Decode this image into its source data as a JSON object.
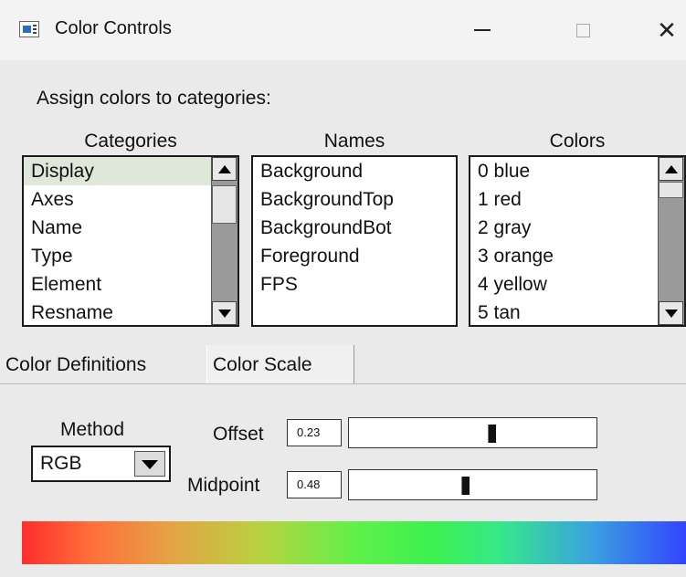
{
  "window": {
    "title": "Color Controls",
    "minimize_glyph": "—",
    "close_glyph": "✕"
  },
  "heading": "Assign colors to categories:",
  "categories": {
    "label": "Categories",
    "items": [
      "Display",
      "Axes",
      "Name",
      "Type",
      "Element",
      "Resname"
    ],
    "selected": "Display"
  },
  "names": {
    "label": "Names",
    "items": [
      "Background",
      "BackgroundTop",
      "BackgroundBot",
      "Foreground",
      "FPS"
    ]
  },
  "colors": {
    "label": "Colors",
    "items": [
      "0 blue",
      "1 red",
      "2 gray",
      "3 orange",
      "4 yellow",
      "5 tan"
    ]
  },
  "tabs": [
    {
      "label": "Color Definitions",
      "active": false
    },
    {
      "label": "Color Scale",
      "active": true
    }
  ],
  "scale": {
    "method_label": "Method",
    "method_value": "RGB",
    "offset_label": "Offset",
    "offset_value": "0.23",
    "offset_fraction": 0.58,
    "midpoint_label": "Midpoint",
    "midpoint_value": "0.48",
    "midpoint_fraction": 0.47
  },
  "colors_hex": {
    "gradient": [
      "#ff2d2d",
      "#e6a145",
      "#62f04a",
      "#35e88a",
      "#3344ff"
    ],
    "selection": "#dfe7d9"
  }
}
